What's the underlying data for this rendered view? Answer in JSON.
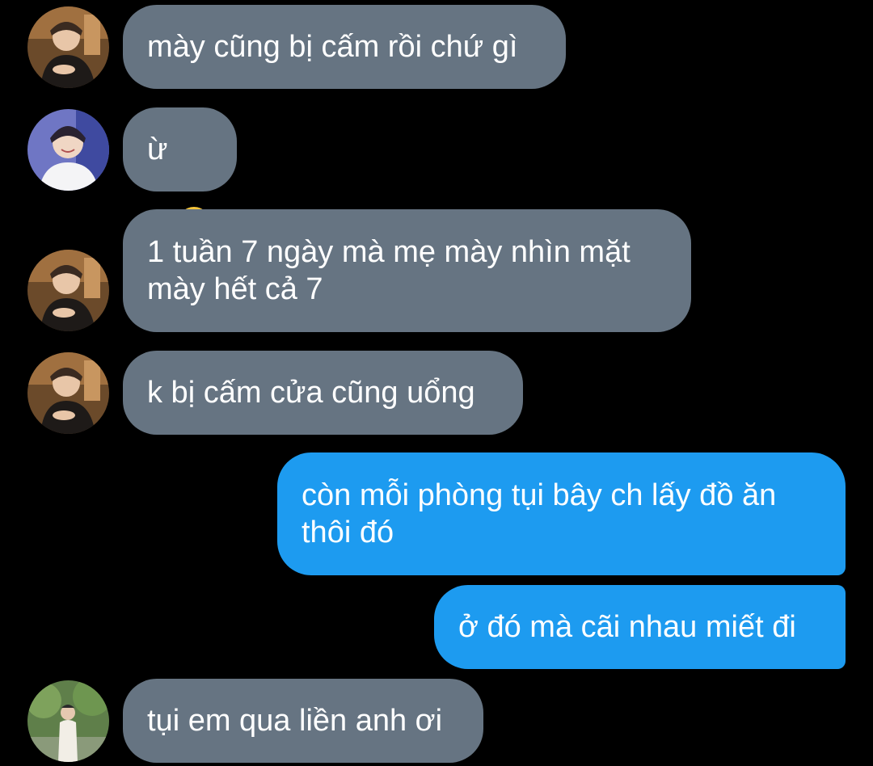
{
  "messages": [
    {
      "side": "in",
      "avatar": "avatar-1",
      "text": "mày cũng bị cấm rồi chứ gì"
    },
    {
      "side": "in",
      "avatar": "avatar-2",
      "text": "ừ",
      "emoji": "sneezing-face-emoji"
    },
    {
      "side": "in",
      "avatar": "avatar-1",
      "text": "1 tuần 7 ngày mà mẹ mày nhìn mặt\nmày hết cả 7"
    },
    {
      "side": "in",
      "avatar": "avatar-1",
      "text": "k bị cấm cửa cũng uổng"
    },
    {
      "side": "out",
      "text": "còn mỗi phòng tụi bây ch lấy đồ ăn\nthôi đó"
    },
    {
      "side": "out",
      "text": "ở đó mà cãi nhau miết đi"
    },
    {
      "side": "in",
      "avatar": "avatar-3",
      "text": "tụi em qua liền anh ơi"
    }
  ],
  "colors": {
    "background": "#000000",
    "incoming_bubble": "#667482",
    "outgoing_bubble": "#1d9bf0",
    "text": "#ffffff"
  }
}
